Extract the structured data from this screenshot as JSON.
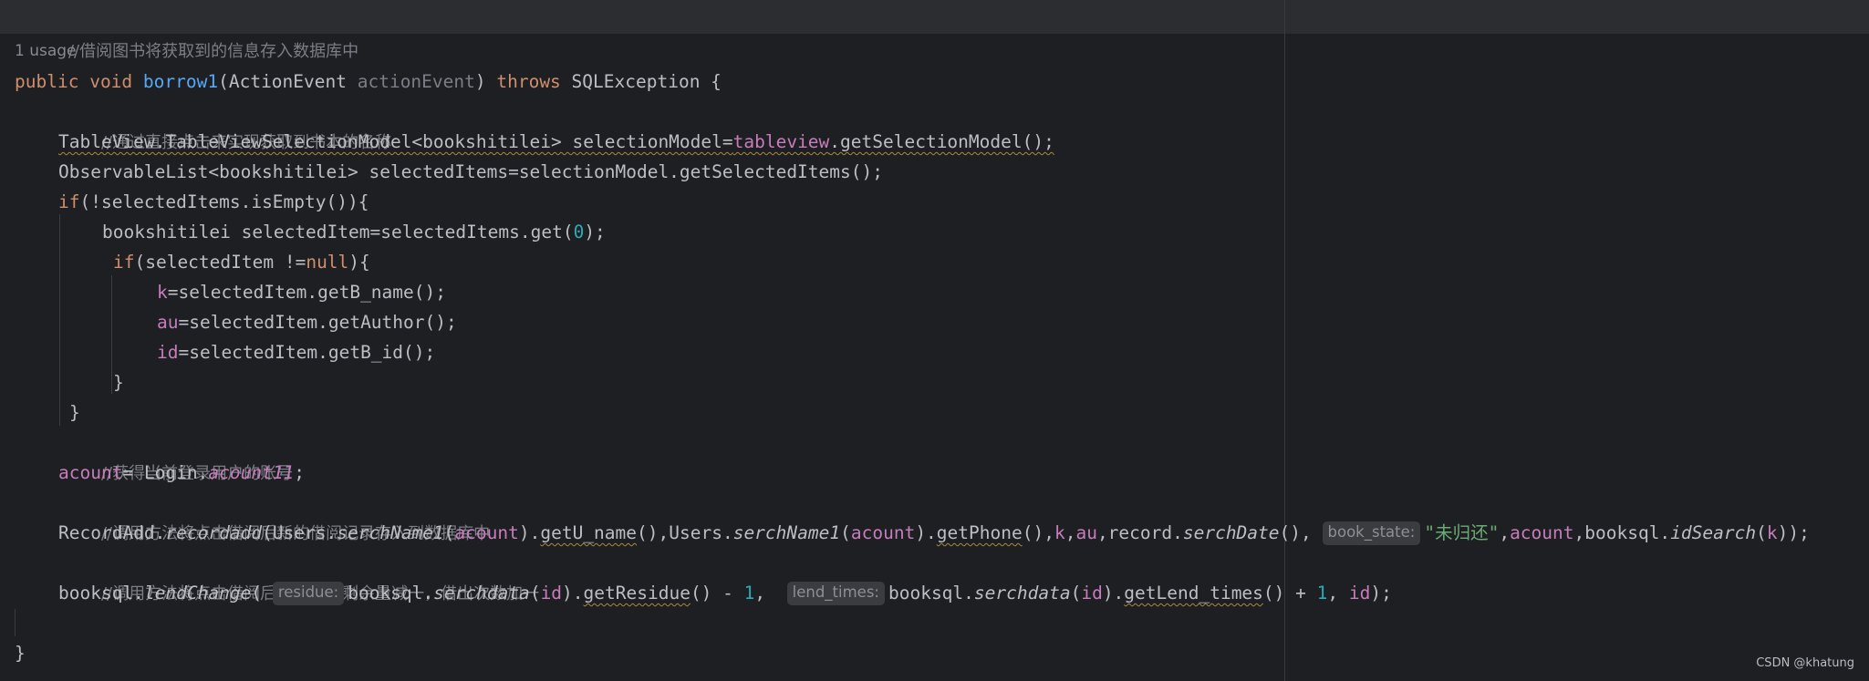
{
  "code": {
    "header_comment": "//借阅图书将获取到的信息存入数据库中",
    "usage": "1 usage",
    "l_sig": {
      "kw1": "public",
      "kw2": "void",
      "name": "borrow1",
      "paren_open": "(ActionEvent ",
      "param": "actionEvent",
      "paren_close": ") ",
      "kw3": "throws",
      "rest": " SQLException {"
    },
    "l_c1": "//通过直接点击来实现获取到书本的名称",
    "l_tv": {
      "a": "TableView.TableViewSelectionModel<bookshitilei> selectionModel=",
      "field": "tableview",
      "b": ".getSelectionModel();"
    },
    "l_ol": "ObservableList<bookshitilei> selectedItems=selectionModel.getSelectedItems();",
    "l_if1": {
      "kw": "if",
      "rest": "(!selectedItems.isEmpty()){"
    },
    "l_get": {
      "a": "bookshitilei selectedItem=selectedItems.get(",
      "num": "0",
      "b": ");"
    },
    "l_if2": {
      "kw": "if",
      "a": "(selectedItem !=",
      "kw2": "null",
      "b": "){"
    },
    "l_k": {
      "field": "k",
      "rest": "=selectedItem.getB_name();"
    },
    "l_au": {
      "field": "au",
      "rest": "=selectedItem.getAuthor();"
    },
    "l_id": {
      "field": "id",
      "rest": "=selectedItem.getB_id();"
    },
    "l_close2": "}",
    "l_close1": "}",
    "l_c2": "//获得当前登录用户的账号",
    "l_acc": {
      "field": "acount",
      "a": "= Login.",
      "static": "acount11",
      "b": ";"
    },
    "l_c3": "//调用方法将点击借阅后新的借阅记录存入到数据库中",
    "l_rec": {
      "t1": "RecordAdd.",
      "m1": "recordadd",
      "t2": "(Users.",
      "m2": "serchName1",
      "t3": "(",
      "f1": "acount",
      "t4": ").",
      "u1": "getU_name",
      "t5": "(),Users.",
      "m3": "serchName1",
      "t6": "(",
      "f2": "acount",
      "t7": ").",
      "u2": "getPhone",
      "t8": "(),",
      "f3": "k",
      "t9": ",",
      "f4": "au",
      "t10": ",record.",
      "m4": "serchDate",
      "t11": "(), ",
      "hint": "book_state:",
      "str": "\"未归还\"",
      "t12": ",",
      "f5": "acount",
      "t13": ",booksql.",
      "m5": "idSearch",
      "t14": "(",
      "f6": "k",
      "t15": "));"
    },
    "l_c4": "//调用方法将点击借阅后该书本的剩余量减一，借出次数加一",
    "l_lend": {
      "t1": "booksql.",
      "m1": "lendChange",
      "t2": "( ",
      "hint1": "residue:",
      "t3": "booksql.",
      "m2": "serchdata",
      "t4": "(",
      "f1": "id",
      "t5": ").",
      "u1": "getResidue",
      "t6": "() - ",
      "n1": "1",
      "t7": ",  ",
      "hint2": "lend_times:",
      "t8": "booksql.",
      "m3": "serchdata",
      "t9": "(",
      "f2": "id",
      "t10": ").",
      "u2": "getLend_times",
      "t11": "() + ",
      "n2": "1",
      "t12": ", ",
      "f3": "id",
      "t13": ");"
    },
    "l_end": "}"
  },
  "watermark": "CSDN @khatung",
  "colors": {
    "background": "#1e1f22",
    "keyword": "#cf8e6d",
    "function": "#56a8f5",
    "field": "#c77dbb",
    "number": "#2aacb8",
    "string": "#6aab73",
    "comment": "#7a7e85",
    "text": "#bcbec4"
  }
}
